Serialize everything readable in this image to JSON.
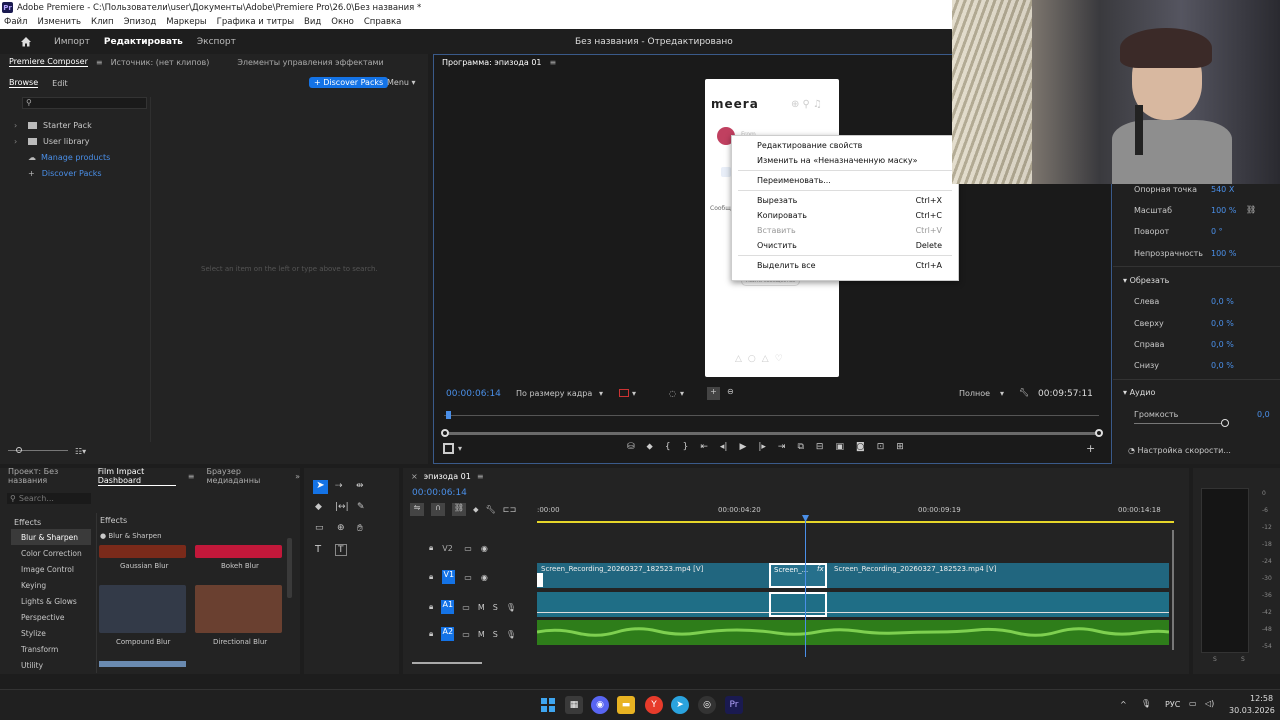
{
  "window": {
    "title": "Adobe Premiere - C:\\Пользователи\\user\\Документы\\Adobe\\Premiere Pro\\26.0\\Без названия *",
    "app_icon": "Pr"
  },
  "menu": [
    "Файл",
    "Изменить",
    "Клип",
    "Эпизод",
    "Маркеры",
    "Графика и титры",
    "Вид",
    "Окно",
    "Справка"
  ],
  "workspaces": {
    "home_icon": "home-icon",
    "import": "Импорт",
    "edit": "Редактировать",
    "export": "Экспорт",
    "doc_title": "Без названия - Отредактировано"
  },
  "left_panel": {
    "tabs": [
      "Premiere Composer",
      "Источник: (нет клипов)",
      "Элементы управления эффектами"
    ],
    "subtabs": [
      "Browse",
      "Edit"
    ],
    "discover_btn": "+ Discover Packs",
    "menu_btn": "Menu",
    "tree": [
      {
        "label": "Starter Pack",
        "type": "folder"
      },
      {
        "label": "User library",
        "type": "folder"
      },
      {
        "label": "Manage products",
        "type": "link"
      },
      {
        "label": "Discover Packs",
        "type": "link"
      }
    ],
    "empty_hint": "Select an item on the left or type above to search."
  },
  "program_monitor": {
    "tab": "Программа: эпизода 01",
    "timecode_in": "00:00:06:14",
    "fit": "По размеру кадра",
    "quality": "Полное",
    "timecode_out": "00:09:57:11",
    "phone_brand": "meera",
    "phone_line1": "From",
    "phone_line2": "Сообщ",
    "phone_button": "Найти сообщество"
  },
  "context_menu": [
    {
      "label": "Редактирование свойств",
      "shortcut": "",
      "disabled": false
    },
    {
      "label": "Изменить на «Неназначенную маску»",
      "shortcut": "",
      "disabled": false
    },
    {
      "sep": true
    },
    {
      "label": "Переименовать...",
      "shortcut": "",
      "disabled": false
    },
    {
      "sep": true
    },
    {
      "label": "Вырезать",
      "shortcut": "Ctrl+X",
      "disabled": false
    },
    {
      "label": "Копировать",
      "shortcut": "Ctrl+C",
      "disabled": false
    },
    {
      "label": "Вставить",
      "shortcut": "Ctrl+V",
      "disabled": true
    },
    {
      "label": "Очистить",
      "shortcut": "Delete",
      "disabled": false
    },
    {
      "sep": true
    },
    {
      "label": "Выделить все",
      "shortcut": "Ctrl+A",
      "disabled": false
    }
  ],
  "effect_controls": {
    "anchor_label": "Опорная точка",
    "anchor_value": "540 X",
    "scale_label": "Масштаб",
    "scale_value": "100 %",
    "rotation_label": "Поворот",
    "rotation_value": "0 °",
    "opacity_label": "Непрозрачность",
    "opacity_value": "100 %",
    "crop_header": "Обрезать",
    "crop": [
      {
        "label": "Слева",
        "value": "0,0 %"
      },
      {
        "label": "Сверху",
        "value": "0,0 %"
      },
      {
        "label": "Справа",
        "value": "0,0 %"
      },
      {
        "label": "Снизу",
        "value": "0,0 %"
      }
    ],
    "audio_header": "Аудио",
    "volume_label": "Громкость",
    "volume_value": "0,0",
    "speed_btn": "Настройка скорости..."
  },
  "bottom_left": {
    "tabs": [
      "Проект: Без названия",
      "Film Impact Dashboard",
      "Браузер медиаданны"
    ],
    "search_placeholder": "Search...",
    "categories_header": "Effects",
    "categories": [
      "Blur & Sharpen",
      "Color Correction",
      "Image Control",
      "Keying",
      "Lights & Glows",
      "Perspective",
      "Stylize",
      "Transform",
      "Utility"
    ],
    "effects_header": "Effects",
    "effects_group": "● Blur & Sharpen",
    "thumbs": [
      {
        "label": "Gaussian Blur",
        "color": "#7a2a1a"
      },
      {
        "label": "Bokeh Blur",
        "color": "#c2183a"
      },
      {
        "label": "Compound Blur",
        "color": "#333a48"
      },
      {
        "label": "Directional Blur",
        "color": "#6a4030"
      }
    ]
  },
  "timeline": {
    "tab": "эпизода 01",
    "timecode": "00:00:06:14",
    "ruler": [
      ":00:00",
      "00:00:04:20",
      "00:00:09:19",
      "00:00:14:18"
    ],
    "tracks": [
      {
        "name": "V2"
      },
      {
        "name": "V1"
      },
      {
        "name": "A1"
      },
      {
        "name": "A2"
      }
    ],
    "clip_left": "Screen_Recording_20260327_182523.mp4 [V]",
    "clip_mid": "Screen_...",
    "clip_right": "Screen_Recording_20260327_182523.mp4 [V]",
    "fx": "fx"
  },
  "meter_labels": [
    "0",
    "-6",
    "-12",
    "-18",
    "-24",
    "-30",
    "-36",
    "-42",
    "-48",
    "-54"
  ],
  "meter_s": [
    "S",
    "S"
  ],
  "taskbar": {
    "lang": "РУС",
    "time": "12:58",
    "date": "30.03.2026"
  }
}
